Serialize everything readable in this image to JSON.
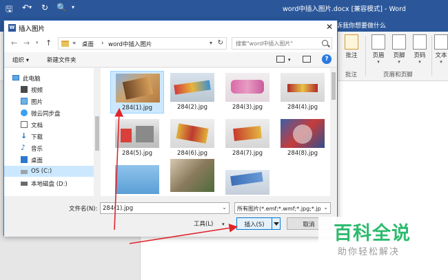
{
  "word": {
    "title": "word中插入图片.docx [兼容模式] - Word",
    "tell_me": "诉我你想要做什么",
    "ribbon": {
      "buttons": [
        {
          "label": "批注",
          "caret": ""
        },
        {
          "label": "页眉",
          "caret": "▾"
        },
        {
          "label": "页脚",
          "caret": "▾"
        },
        {
          "label": "页码",
          "caret": "▾"
        },
        {
          "label": "文本",
          "caret": "▾"
        }
      ],
      "groups": {
        "comment": "批注",
        "header_footer": "页眉和页脚"
      }
    }
  },
  "dialog": {
    "title": "插入图片",
    "address": {
      "sep1": "«",
      "crumb1": "桌面",
      "sep2": "›",
      "crumb2": "word中插入图片"
    },
    "search_placeholder": "搜索\"word中插入图片\"",
    "toolbar": {
      "organize": "组织 ▾",
      "new_folder": "新建文件夹"
    },
    "nav": [
      {
        "label": "此电脑",
        "icon": "computer-icon",
        "root": true
      },
      {
        "label": "视频",
        "icon": "video-icon"
      },
      {
        "label": "图片",
        "icon": "pictures-icon"
      },
      {
        "label": "微云同步盘",
        "icon": "cloud-icon"
      },
      {
        "label": "文档",
        "icon": "documents-icon"
      },
      {
        "label": "下载",
        "icon": "download-icon"
      },
      {
        "label": "音乐",
        "icon": "music-icon"
      },
      {
        "label": "桌面",
        "icon": "desktop-icon"
      },
      {
        "label": "OS (C:)",
        "icon": "drive-icon",
        "selected": true
      },
      {
        "label": "本地磁盘 (D:)",
        "icon": "drive-icon"
      }
    ],
    "files": [
      {
        "name": "284(1).jpg",
        "selected": true
      },
      {
        "name": "284(2).jpg"
      },
      {
        "name": "284(3).jpg"
      },
      {
        "name": "284(4).jpg"
      },
      {
        "name": "284(5).jpg"
      },
      {
        "name": "284(6).jpg"
      },
      {
        "name": "284(7).jpg"
      },
      {
        "name": "284(8).jpg"
      },
      {
        "name": ""
      },
      {
        "name": ""
      },
      {
        "name": ""
      }
    ],
    "filename_label": "文件名(N):",
    "filename_value": "284(1).jpg",
    "filter": "所有图片(*.emf;*.wmf;*.jpg;*.jp",
    "tools": "工具(L)",
    "insert": "插入(S)",
    "cancel": "取消"
  },
  "watermark": {
    "big": "百科全说",
    "small": "助你轻松解决"
  },
  "colors": {
    "word_blue": "#2b579a",
    "selection": "#cce8ff",
    "arrow_red": "#e0242a",
    "watermark_green": "#2dbb6e"
  }
}
